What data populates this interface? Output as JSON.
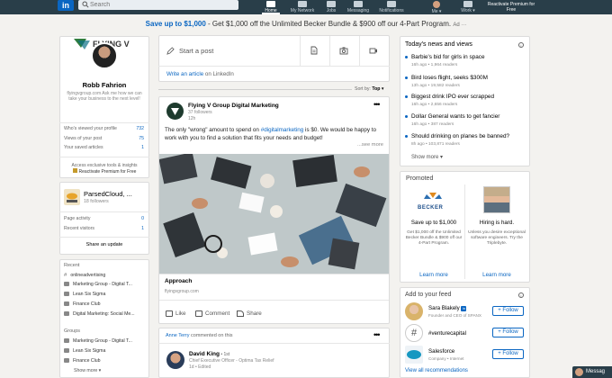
{
  "topnav": {
    "search_placeholder": "Search",
    "items": [
      {
        "label": "Home"
      },
      {
        "label": "My Network"
      },
      {
        "label": "Jobs"
      },
      {
        "label": "Messaging"
      },
      {
        "label": "Notifications"
      },
      {
        "label": "Me ▾"
      },
      {
        "label": "Work ▾"
      }
    ],
    "premium": "Reactivate Premium for Free"
  },
  "ad_banner": {
    "lead": "Save up to $1,000",
    "text": " - Get $1,000 off the Unlimited Becker Bundle & $900 off our 4-Part Program.",
    "ad_label": "Ad ···"
  },
  "profile": {
    "name": "Robb Fahrion",
    "headline": "flyingvgroup.com Ask me how we can take your business to the next level!",
    "stats": [
      {
        "label": "Who's viewed your profile",
        "value": "732"
      },
      {
        "label": "Views of your post",
        "value": "75"
      },
      {
        "label": "Your saved articles",
        "value": "1"
      }
    ],
    "promo": "Access exclusive tools & insights",
    "promo_link": "Reactivate Premium for Free"
  },
  "page": {
    "name": "ParsedCloud, ...",
    "followers": "18 followers",
    "stats": [
      {
        "label": "Page activity",
        "value": "0"
      },
      {
        "label": "Recent visitors",
        "value": "1"
      }
    ],
    "share_label": "Share an update"
  },
  "recent": {
    "title": "Recent",
    "items": [
      "onlineadvertising",
      "Marketing Group - Digital T...",
      "Lean Six Sigma",
      "Finance Club",
      "Digital Marketing: Social Me..."
    ]
  },
  "groups": {
    "title": "Groups",
    "items": [
      "Marketing Group - Digital T...",
      "Lean Six Sigma",
      "Finance Club"
    ],
    "show_more": "Show more ▾"
  },
  "share_box": {
    "start_post": "Start a post",
    "write_article": "Write an article",
    "write_article_suffix": " on LinkedIn",
    "sort_by": "Sort by:",
    "sort_value": "Top ▾"
  },
  "post": {
    "author": "Flying V Group Digital Marketing",
    "followers": "37 followers",
    "time": "12h",
    "text_1": "The only \"wrong\" amount to spend on ",
    "hashtag": "#digitalmarketing",
    "text_2": " is $0. We would be happy to work with you to find a solution that fits your needs and budget!",
    "see_more": "...see more",
    "caption": "Approach",
    "domain": "flyingvgroup.com",
    "actions": {
      "like": "Like",
      "comment": "Comment",
      "share": "Share"
    }
  },
  "post2": {
    "actor": "Anne Terry",
    "activity": " commented on this",
    "author": "David King",
    "degree": " • 1st",
    "title": "Chief Executive Officer - Optima Tax Relief",
    "time": "1d • Edited"
  },
  "news": {
    "title": "Today's news and views",
    "items": [
      {
        "headline": "Barbie's bid for girls in space",
        "meta": "16h ago • 1,964 readers"
      },
      {
        "headline": "Bird loses flight, seeks $300M",
        "meta": "13h ago • 19,582 readers"
      },
      {
        "headline": "Biggest drink IPO ever scrapped",
        "meta": "16h ago • 2,656 readers"
      },
      {
        "headline": "Dollar General wants to get fancier",
        "meta": "16h ago • 387 readers"
      },
      {
        "headline": "Should drinking on planes be banned?",
        "meta": "8h ago • 103,871 readers"
      }
    ],
    "show_more": "Show more ▾"
  },
  "promoted": {
    "title": "Promoted",
    "ads": [
      {
        "logo": "BECKER",
        "headline": "Save up to $1,000",
        "body": "Get $1,000 off the Unlimited Becker Bundle & $900 off our 4-Part Program.",
        "cta": "Learn more"
      },
      {
        "headline": "Hiring is hard.",
        "body": "Unless you desire exceptional software engineers. Try the Triplebyte.",
        "cta": "Learn more"
      }
    ]
  },
  "feed": {
    "title": "Add to your feed",
    "items": [
      {
        "name": "Sara Blakely",
        "sub": "Founder and CEO of SPANX",
        "button": "+ Follow"
      },
      {
        "name": "#venturecapital",
        "sub": "",
        "button": "+ Follow"
      },
      {
        "name": "Salesforce",
        "sub": "Company • Internet",
        "button": "+ Follow"
      }
    ],
    "all_recs": "View all recommendations"
  },
  "messaging": {
    "label": "Messag"
  },
  "colors": {
    "nav": "#293e49",
    "accent": "#0a66c2",
    "background": "#f3f2ef"
  }
}
